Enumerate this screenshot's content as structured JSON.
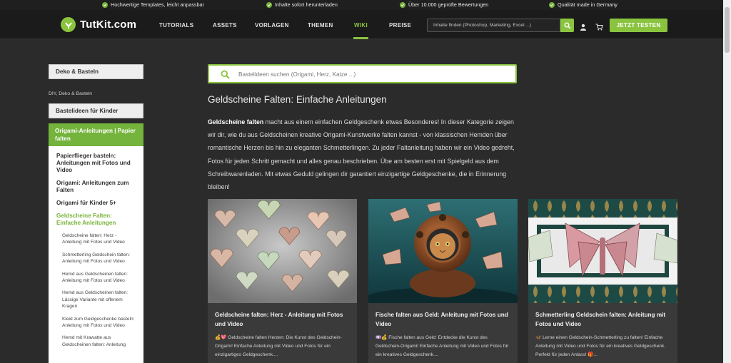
{
  "usp_bar": [
    "Hochwertige Templates, leicht anpassbar",
    "Inhalte sofort herunterladen",
    "Über 10.000 geprüfte Bewertungen",
    "Qualität made in Germany"
  ],
  "header": {
    "logo": "TutKit.com",
    "nav": [
      "TUTORIALS",
      "ASSETS",
      "VORLAGEN",
      "THEMEN",
      "WIKI",
      "PREISE"
    ],
    "active_nav": "WIKI",
    "search_placeholder": "Inhalte finden (Photoshop, Marketing, Excel ...)",
    "cta": "JETZT TESTEN"
  },
  "sidebar": {
    "top_button": "Deko & Basteln",
    "section_label": "DIY, Deko & Basteln",
    "second_button": "Bastelideen für Kinder",
    "active_category": "Origami-Anleitungen | Papier falten",
    "items": [
      "Papierflieger basteln: Anleitungen mit Fotos und Video",
      "Origami: Anleitungen zum Falten",
      "Origami für Kinder 5+",
      "Geldscheine Falten: Einfache Anleitungen"
    ],
    "subitems": [
      "Geldscheine falten: Herz - Anleitung mit Fotos und Video",
      "Schmetterling Geldschein falten: Anleitung mit Fotos und Video",
      "Hemd aus Geldscheinen falten: Anleitung mit Fotos und Video",
      "Hemd aus Geldscheinen falten: Lässige Variante mit offenem Kragen",
      "Kleid zum Geldgeschenke basteln: Anleitung mit Fotos und Video",
      "Hemd mit Krawatte aus Geldscheinen falten: Anleitung"
    ]
  },
  "main": {
    "search_placeholder": "Bastelideen suchen (Origami, Herz, Katze ...)",
    "title": "Geldscheine Falten: Einfache Anleitungen",
    "intro_bold": "Geldscheine falten",
    "intro_rest": " macht aus einem einfachen Geldgeschenk etwas Besonderes! In dieser Kategorie zeigen wir dir, wie du aus Geldscheinen kreative Origami-Kunstwerke falten kannst - von klassischen Hemden über romantische Herzen bis hin zu eleganten Schmetterlingen. Zu jeder Faltanleitung haben wir ein Video gedreht, Fotos für jeden Schritt gemacht und alles genau beschrieben. Übe am besten erst mit Spielgeld aus dem Schreibwarenladen. Mit etwas Geduld gelingen dir garantiert einzigartige Geldgeschenke, die in Erinnerung bleiben!",
    "cards": [
      {
        "title": "Geldscheine falten: Herz - Anleitung mit Fotos und Video",
        "emoji": "💰💖",
        "desc": "Geldscheine falten Herzen: Die Kunst des Geldschein-Origami! Einfache Anleitung mit Video und Fotos für ein einzigartiges Geldgeschenk...."
      },
      {
        "title": "Fische falten aus Geld: Anleitung mit Fotos und Video",
        "emoji": "💷💰",
        "desc": "Fische falten aus Geld: Entdecke die Kunst des Geldschein-Origami! Einfache Anleitung mit Video und Fotos für ein kreatives Geldgeschenk...."
      },
      {
        "title": "Schmetterling Geldschein falten: Anleitung mit Fotos und Video",
        "emoji": "🦋",
        "desc": "Lerne einen Geldschein-Schmetterling zu falten! Einfache Anleitung mit Video und Fotos für ein kreatives Geldgeschenk. Perfekt für jeden Anlass! 🎁..."
      }
    ]
  },
  "colors": {
    "accent": "#8ac43f",
    "page_bg": "#2b2b2b",
    "nav_bg": "#1b1b1b",
    "card_bg": "#3a3a3a"
  }
}
